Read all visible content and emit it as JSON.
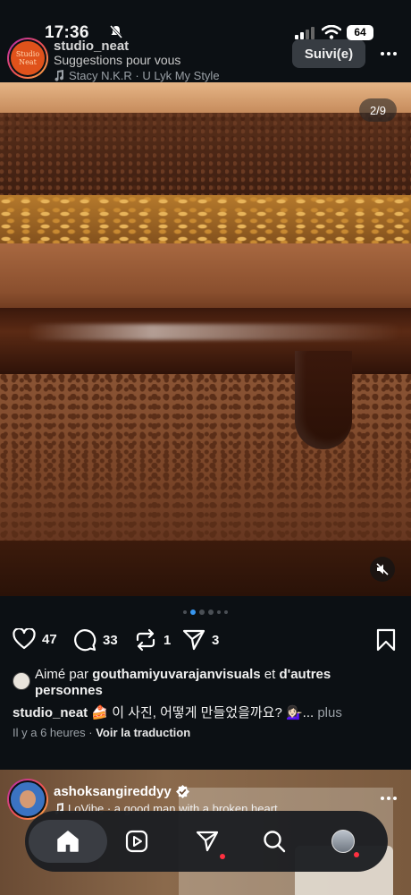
{
  "status_bar": {
    "time": "17:36",
    "battery": "64"
  },
  "post": {
    "username": "studio_neat",
    "subtitle": "Suggestions pour vous",
    "music": "Stacy N.K.R · U Lyk My Style",
    "follow_label": "Suivi(e)",
    "avatar_text": "Studio Neat",
    "image_counter": "2/9",
    "likes": "47",
    "comments": "33",
    "reposts": "1",
    "shares": "3",
    "liked_by_prefix": "Aimé par ",
    "liked_by_user": "gouthamiyuvarajanvisuals",
    "liked_by_suffix": " et ",
    "liked_by_others": "d'autres personnes",
    "caption_user": "studio_neat",
    "caption_text": " 🍰 이 사진, 어떻게 만들었을까요? 💁🏻‍♀️...",
    "caption_more": " plus",
    "time_ago": "Il y a 6 heures",
    "separator": " · ",
    "translate": "Voir la traduction"
  },
  "post2": {
    "username": "ashoksangireddyy",
    "music": "LoVibe · a good man with a broken heart"
  },
  "icons": {
    "like": "heart-icon",
    "comment": "comment-icon",
    "repost": "repost-icon",
    "share": "send-icon",
    "save": "bookmark-icon"
  },
  "nav": [
    "home-icon",
    "reels-icon",
    "messages-icon",
    "search-icon",
    "profile-avatar"
  ],
  "colors": {
    "background": "#0c1014",
    "accent": "#3897f0",
    "notification": "#ff3040"
  }
}
